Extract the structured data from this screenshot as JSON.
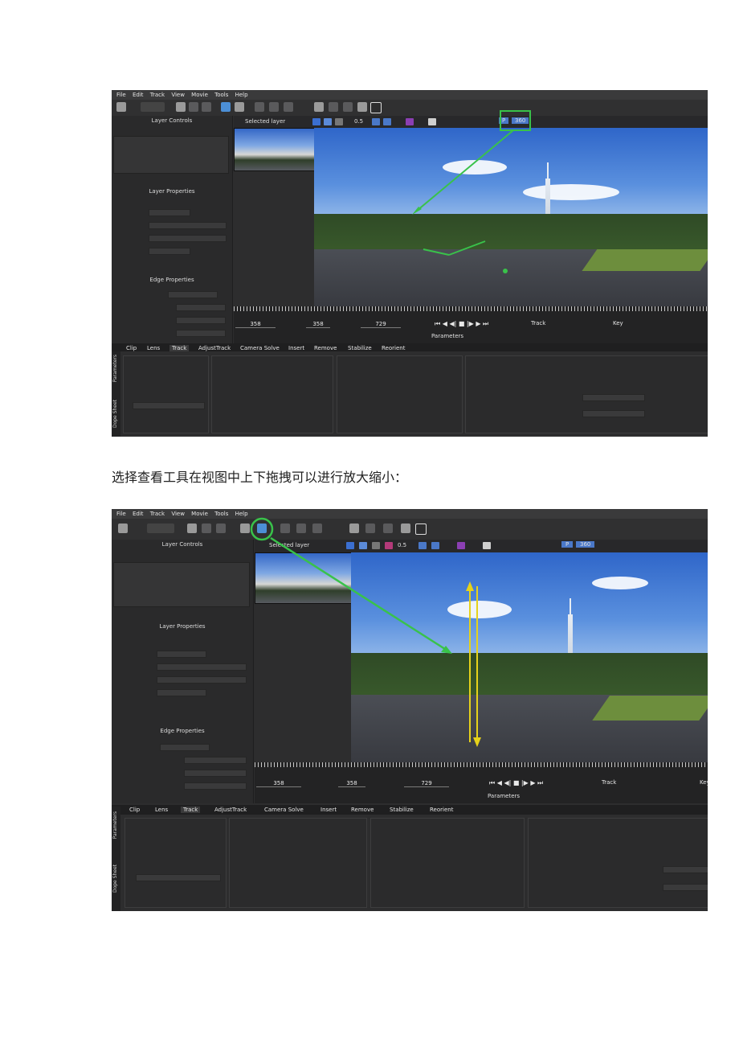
{
  "caption": "选择查看工具在视图中上下拖拽可以进行放大缩小：",
  "app": {
    "menu": [
      "File",
      "Edit",
      "Track",
      "View",
      "Movie",
      "Tools",
      "Help"
    ],
    "layer_controls_title": "Layer Controls",
    "layer_properties_title": "Layer Properties",
    "edge_properties_title": "Edge Properties",
    "layer_dropdown": "Selected layer",
    "opacity_value": "0.5",
    "badge_p": "P",
    "badge_360": "360",
    "timeline": {
      "in_frame": "358",
      "current_frame": "358",
      "out_frame": "729",
      "track_label": "Track",
      "key_label": "Key",
      "parameters_label": "Parameters"
    },
    "tabs": [
      "Clip",
      "Lens",
      "Track",
      "AdjustTrack",
      "Camera Solve",
      "Insert",
      "Remove",
      "Stabilize",
      "Reorient"
    ],
    "active_tab": "Track",
    "side_tabs": [
      "Parameters",
      "Dope Sheet"
    ]
  },
  "annotations": {
    "highlight_color": "#39c24a",
    "drag_arrow_color": "#e6d21a"
  }
}
